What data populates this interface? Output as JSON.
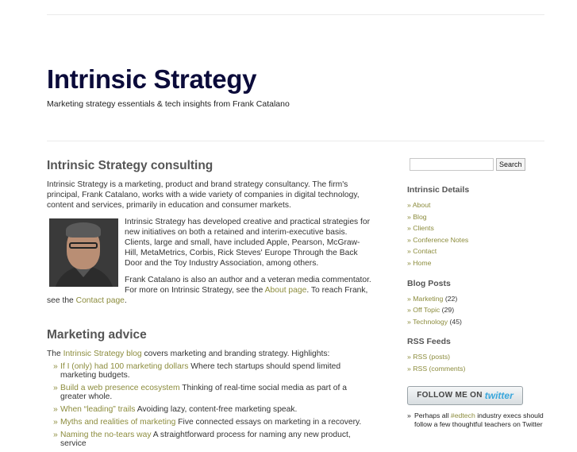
{
  "site": {
    "title": "Intrinsic Strategy",
    "tagline": "Marketing strategy essentials & tech insights from Frank Catalano"
  },
  "consulting": {
    "heading": "Intrinsic Strategy consulting",
    "para1": "Intrinsic Strategy is a marketing, product and brand strategy consultancy. The firm's principal, Frank Catalano, works with a wide variety of companies in digital technology, content and services, primarily in education and consumer markets.",
    "para2": "Intrinsic Strategy has developed creative and practical strategies for new initiatives on both a retained and interim-executive basis. Clients, large and small, have included Apple, Pearson, McGraw-Hill, MetaMetrics, Corbis, Rick Steves' Europe Through the Back Door and the Toy Industry Association, among others.",
    "para3_a": "Frank Catalano is also an author and a veteran media commentator. For more on Intrinsic Strategy, see the ",
    "para3_link1": "About page",
    "para3_b": ". To reach Frank, see the ",
    "para3_link2": "Contact page",
    "para3_c": "."
  },
  "advice": {
    "heading": "Marketing advice",
    "intro_a": "The ",
    "intro_link": "Intrinsic Strategy blog",
    "intro_b": " covers marketing and branding strategy. Highlights:",
    "items": [
      {
        "link": "If I (only) had 100 marketing dollars",
        "text": " Where tech startups should spend limited marketing budgets."
      },
      {
        "link": "Build a web presence ecosystem",
        "text": " Thinking of real-time social media as part of a greater whole."
      },
      {
        "link": "When “leading” trails",
        "text": " Avoiding lazy, content-free marketing speak."
      },
      {
        "link": "Myths and realities of marketing",
        "text": " Five connected essays on marketing in a recovery."
      },
      {
        "link": "Naming the no-tears way",
        "text": " A straightforward process for naming any new product, service"
      }
    ]
  },
  "sidebar": {
    "search": {
      "placeholder": "",
      "button": "Search"
    },
    "details": {
      "title": "Intrinsic Details",
      "items": [
        "About",
        "Blog",
        "Clients",
        "Conference Notes",
        "Contact",
        "Home"
      ]
    },
    "posts": {
      "title": "Blog Posts",
      "items": [
        {
          "label": "Marketing",
          "count": "(22)"
        },
        {
          "label": "Off Topic",
          "count": "(29)"
        },
        {
          "label": "Technology",
          "count": "(45)"
        }
      ]
    },
    "rss": {
      "title": "RSS Feeds",
      "items": [
        "RSS (posts)",
        "RSS (comments)"
      ]
    },
    "twitter": {
      "label": "FOLLOW ME ON",
      "brand": "twitter",
      "tweet_a": "Perhaps all ",
      "tweet_link": "#edtech",
      "tweet_b": " industry execs should follow a few thoughtful teachers on Twitter"
    }
  },
  "colors": {
    "link": "#8c8c3d",
    "title": "#0b0b3a",
    "twitter_blue": "#3aa7dc"
  },
  "icons": {
    "photo": "frank-catalano-portrait"
  }
}
